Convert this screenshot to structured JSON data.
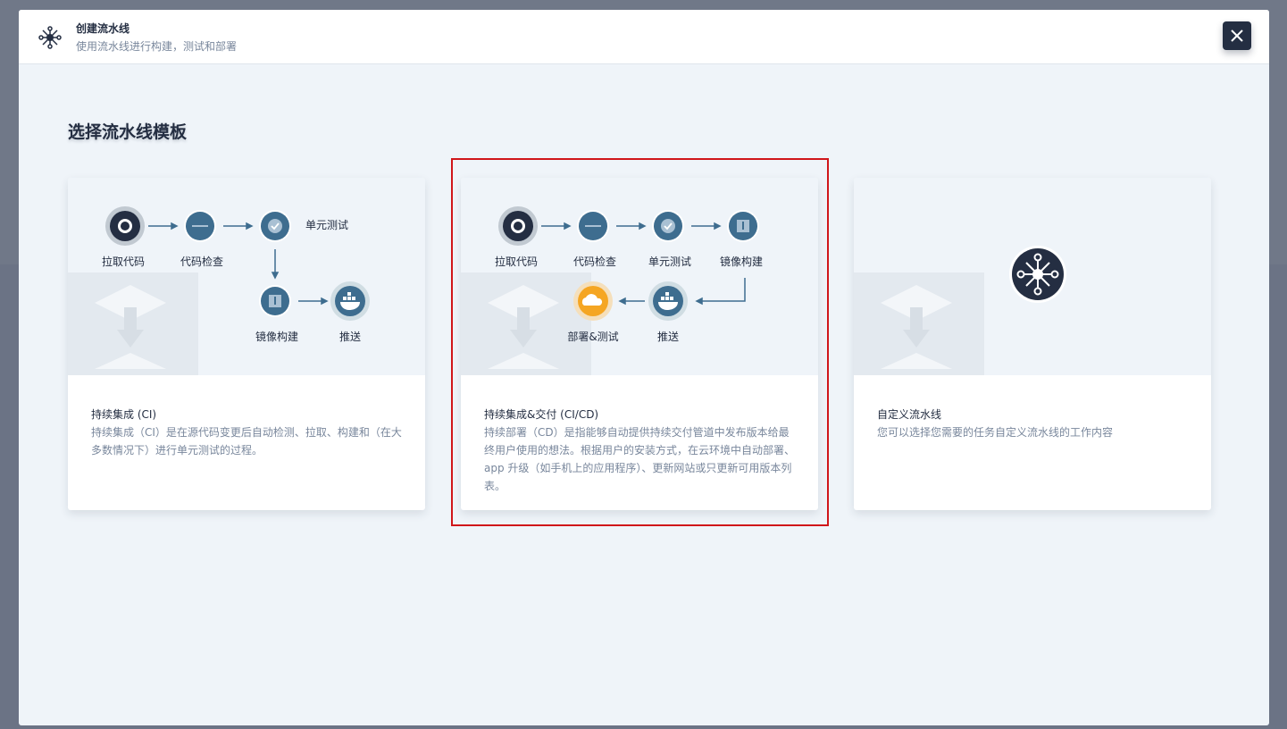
{
  "header": {
    "title": "创建流水线",
    "description": "使用流水线进行构建，测试和部署",
    "close_label": "×"
  },
  "section_title": "选择流水线模板",
  "templates": [
    {
      "title": "持续集成 (CI)",
      "description": "持续集成（CI）是在源代码变更后自动检测、拉取、构建和（在大多数情况下）进行单元测试的过程。",
      "steps": [
        "拉取代码",
        "代码检查",
        "单元测试",
        "镜像构建",
        "推送"
      ]
    },
    {
      "title": "持续集成&交付 (CI/CD)",
      "description": "持续部署（CD）是指能够自动提供持续交付管道中发布版本给最终用户使用的想法。根据用户的安装方式，在云环境中自动部署、app 升级（如手机上的应用程序）、更新网站或只更新可用版本列表。",
      "steps": [
        "拉取代码",
        "代码检查",
        "单元测试",
        "镜像构建",
        "推送",
        "部署&测试"
      ]
    },
    {
      "title": "自定义流水线",
      "description": "您可以选择您需要的任务自定义流水线的工作内容"
    }
  ],
  "colors": {
    "dark": "#242e42",
    "accent": "#3e6d8f",
    "muted": "#79879c",
    "highlight": "#d0161a",
    "deploy": "#f5a623"
  },
  "icons": [
    "github-icon",
    "sonarqube-icon",
    "check-icon",
    "image-build-icon",
    "docker-icon",
    "cloud-icon",
    "pipeline-icon"
  ]
}
